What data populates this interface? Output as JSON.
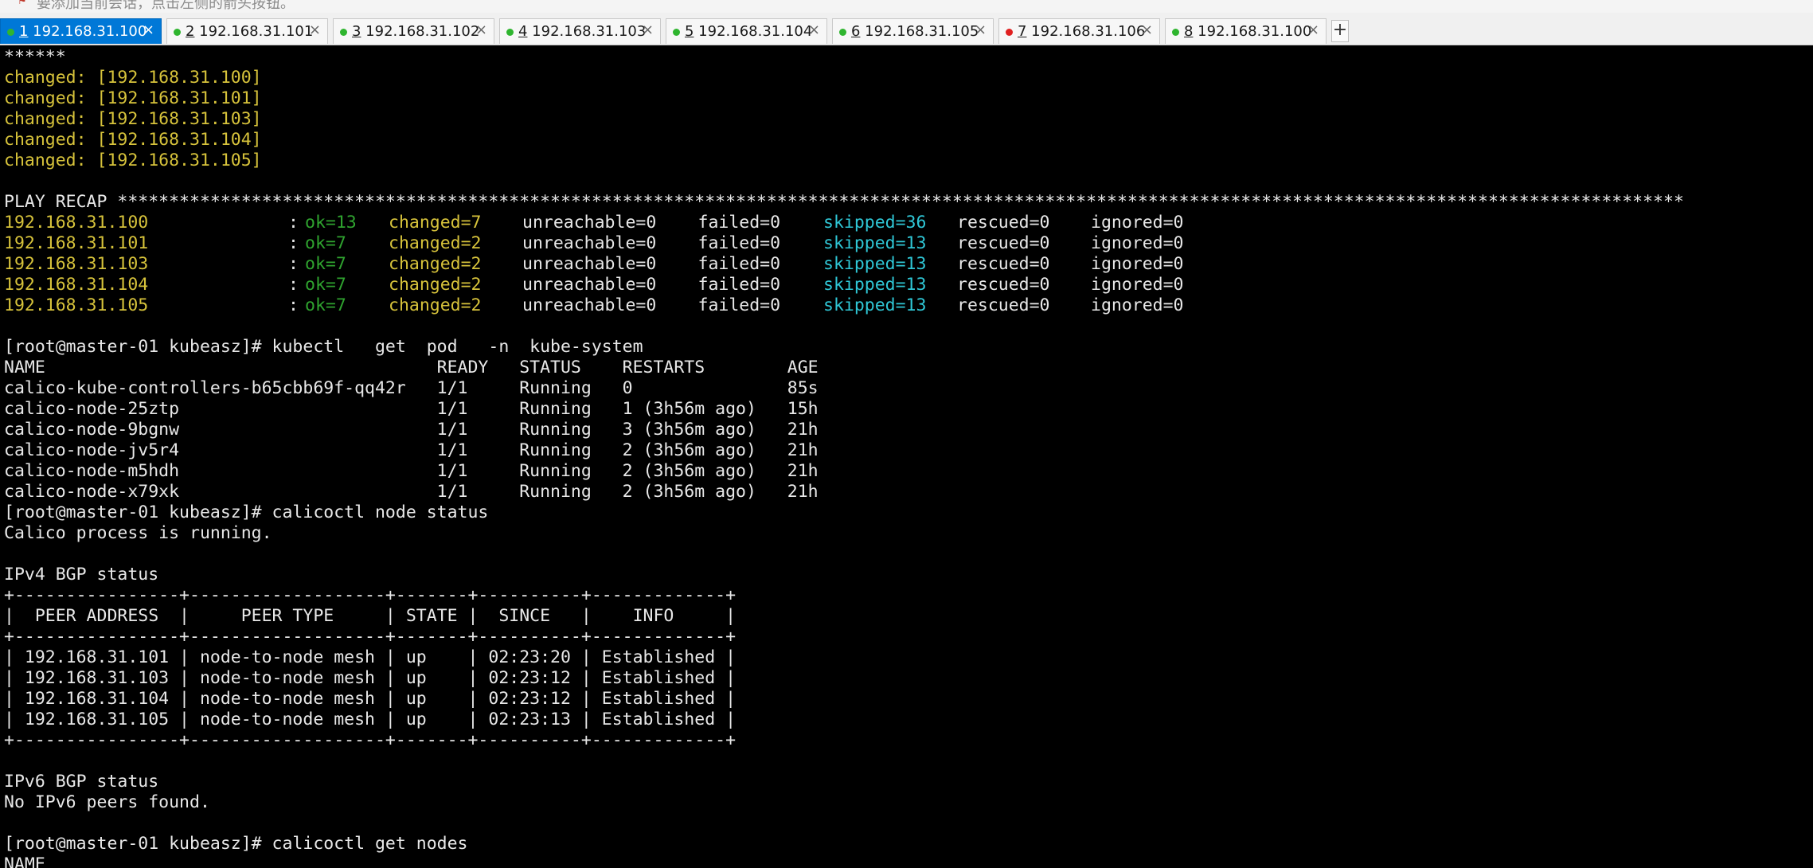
{
  "hint": {
    "text": "要添加当前会话，点击左侧的箭头按钮。"
  },
  "tabs": [
    {
      "num": "1",
      "host": "192.168.31.100",
      "status": "#2fb52f",
      "active": true
    },
    {
      "num": "2",
      "host": "192.168.31.101",
      "status": "#2fb52f",
      "active": false
    },
    {
      "num": "3",
      "host": "192.168.31.102",
      "status": "#2fb52f",
      "active": false
    },
    {
      "num": "4",
      "host": "192.168.31.103",
      "status": "#2fb52f",
      "active": false
    },
    {
      "num": "5",
      "host": "192.168.31.104",
      "status": "#2fb52f",
      "active": false
    },
    {
      "num": "6",
      "host": "192.168.31.105",
      "status": "#2fb52f",
      "active": false
    },
    {
      "num": "7",
      "host": "192.168.31.106",
      "status": "#e02020",
      "active": false
    },
    {
      "num": "8",
      "host": "192.168.31.100",
      "status": "#2fb52f",
      "active": false
    }
  ],
  "tab_close": "×",
  "new_tab_label": "+",
  "colors": {
    "yellow": "#d7c33b",
    "green": "#2fa32f",
    "cyan": "#2fc7d6",
    "text": "#e8e8e8",
    "tab_active": "#0078d7"
  },
  "terminal": {
    "lines": [
      {
        "segments": [
          {
            "t": "******",
            "c": ""
          }
        ]
      },
      {
        "segments": [
          {
            "t": "changed: [192.168.31.100]",
            "c": "yellow"
          }
        ]
      },
      {
        "segments": [
          {
            "t": "changed: [192.168.31.101]",
            "c": "yellow"
          }
        ]
      },
      {
        "segments": [
          {
            "t": "changed: [192.168.31.103]",
            "c": "yellow"
          }
        ]
      },
      {
        "segments": [
          {
            "t": "changed: [192.168.31.104]",
            "c": "yellow"
          }
        ]
      },
      {
        "segments": [
          {
            "t": "changed: [192.168.31.105]",
            "c": "yellow"
          }
        ]
      },
      {
        "segments": [
          {
            "t": "",
            "c": ""
          }
        ]
      },
      {
        "segments": [
          {
            "t": "PLAY RECAP ********************************************************************************************************************************************************",
            "c": ""
          }
        ]
      },
      {
        "segments": [
          {
            "t": "192.168.31.100",
            "c": "yellow",
            "col": 0
          },
          {
            "t": ": ",
            "c": "",
            "col": 34
          },
          {
            "t": "ok=13",
            "c": "green",
            "col": 36
          },
          {
            "t": "changed=7",
            "c": "yellow",
            "col": 46
          },
          {
            "t": "unreachable=0",
            "c": "",
            "col": 62
          },
          {
            "t": "failed=0",
            "c": "",
            "col": 83
          },
          {
            "t": "skipped=36",
            "c": "cyan",
            "col": 98
          },
          {
            "t": "rescued=0",
            "c": "",
            "col": 114
          },
          {
            "t": "ignored=0",
            "c": "",
            "col": 130
          }
        ]
      },
      {
        "segments": [
          {
            "t": "192.168.31.101",
            "c": "yellow",
            "col": 0
          },
          {
            "t": ": ",
            "c": "",
            "col": 34
          },
          {
            "t": "ok=7",
            "c": "green",
            "col": 36
          },
          {
            "t": "changed=2",
            "c": "yellow",
            "col": 46
          },
          {
            "t": "unreachable=0",
            "c": "",
            "col": 62
          },
          {
            "t": "failed=0",
            "c": "",
            "col": 83
          },
          {
            "t": "skipped=13",
            "c": "cyan",
            "col": 98
          },
          {
            "t": "rescued=0",
            "c": "",
            "col": 114
          },
          {
            "t": "ignored=0",
            "c": "",
            "col": 130
          }
        ]
      },
      {
        "segments": [
          {
            "t": "192.168.31.103",
            "c": "yellow",
            "col": 0
          },
          {
            "t": ": ",
            "c": "",
            "col": 34
          },
          {
            "t": "ok=7",
            "c": "green",
            "col": 36
          },
          {
            "t": "changed=2",
            "c": "yellow",
            "col": 46
          },
          {
            "t": "unreachable=0",
            "c": "",
            "col": 62
          },
          {
            "t": "failed=0",
            "c": "",
            "col": 83
          },
          {
            "t": "skipped=13",
            "c": "cyan",
            "col": 98
          },
          {
            "t": "rescued=0",
            "c": "",
            "col": 114
          },
          {
            "t": "ignored=0",
            "c": "",
            "col": 130
          }
        ]
      },
      {
        "segments": [
          {
            "t": "192.168.31.104",
            "c": "yellow",
            "col": 0
          },
          {
            "t": ": ",
            "c": "",
            "col": 34
          },
          {
            "t": "ok=7",
            "c": "green",
            "col": 36
          },
          {
            "t": "changed=2",
            "c": "yellow",
            "col": 46
          },
          {
            "t": "unreachable=0",
            "c": "",
            "col": 62
          },
          {
            "t": "failed=0",
            "c": "",
            "col": 83
          },
          {
            "t": "skipped=13",
            "c": "cyan",
            "col": 98
          },
          {
            "t": "rescued=0",
            "c": "",
            "col": 114
          },
          {
            "t": "ignored=0",
            "c": "",
            "col": 130
          }
        ]
      },
      {
        "segments": [
          {
            "t": "192.168.31.105",
            "c": "yellow",
            "col": 0
          },
          {
            "t": ": ",
            "c": "",
            "col": 34
          },
          {
            "t": "ok=7",
            "c": "green",
            "col": 36
          },
          {
            "t": "changed=2",
            "c": "yellow",
            "col": 46
          },
          {
            "t": "unreachable=0",
            "c": "",
            "col": 62
          },
          {
            "t": "failed=0",
            "c": "",
            "col": 83
          },
          {
            "t": "skipped=13",
            "c": "cyan",
            "col": 98
          },
          {
            "t": "rescued=0",
            "c": "",
            "col": 114
          },
          {
            "t": "ignored=0",
            "c": "",
            "col": 130
          }
        ]
      },
      {
        "segments": [
          {
            "t": "",
            "c": ""
          }
        ]
      },
      {
        "segments": [
          {
            "t": "[root@master-01 kubeasz]# kubectl   get  pod   -n  kube-system",
            "c": ""
          }
        ]
      },
      {
        "segments": [
          {
            "t": "NAME                                      READY   STATUS    RESTARTS        AGE",
            "c": ""
          }
        ]
      },
      {
        "segments": [
          {
            "t": "calico-kube-controllers-b65cbb69f-qq42r   1/1     Running   0               85s",
            "c": ""
          }
        ]
      },
      {
        "segments": [
          {
            "t": "calico-node-25ztp                         1/1     Running   1 (3h56m ago)   15h",
            "c": ""
          }
        ]
      },
      {
        "segments": [
          {
            "t": "calico-node-9bgnw                         1/1     Running   3 (3h56m ago)   21h",
            "c": ""
          }
        ]
      },
      {
        "segments": [
          {
            "t": "calico-node-jv5r4                         1/1     Running   2 (3h56m ago)   21h",
            "c": ""
          }
        ]
      },
      {
        "segments": [
          {
            "t": "calico-node-m5hdh                         1/1     Running   2 (3h56m ago)   21h",
            "c": ""
          }
        ]
      },
      {
        "segments": [
          {
            "t": "calico-node-x79xk                         1/1     Running   2 (3h56m ago)   21h",
            "c": ""
          }
        ]
      },
      {
        "segments": [
          {
            "t": "[root@master-01 kubeasz]# calicoctl node status",
            "c": ""
          }
        ]
      },
      {
        "segments": [
          {
            "t": "Calico process is running.",
            "c": ""
          }
        ]
      },
      {
        "segments": [
          {
            "t": "",
            "c": ""
          }
        ]
      },
      {
        "segments": [
          {
            "t": "IPv4 BGP status",
            "c": ""
          }
        ]
      },
      {
        "segments": [
          {
            "t": "+----------------+-------------------+-------+----------+-------------+",
            "c": ""
          }
        ]
      },
      {
        "segments": [
          {
            "t": "|  PEER ADDRESS  |     PEER TYPE     | STATE |  SINCE   |    INFO     |",
            "c": ""
          }
        ]
      },
      {
        "segments": [
          {
            "t": "+----------------+-------------------+-------+----------+-------------+",
            "c": ""
          }
        ]
      },
      {
        "segments": [
          {
            "t": "| 192.168.31.101 | node-to-node mesh | up    | 02:23:20 | Established |",
            "c": ""
          }
        ]
      },
      {
        "segments": [
          {
            "t": "| 192.168.31.103 | node-to-node mesh | up    | 02:23:12 | Established |",
            "c": ""
          }
        ]
      },
      {
        "segments": [
          {
            "t": "| 192.168.31.104 | node-to-node mesh | up    | 02:23:12 | Established |",
            "c": ""
          }
        ]
      },
      {
        "segments": [
          {
            "t": "| 192.168.31.105 | node-to-node mesh | up    | 02:23:13 | Established |",
            "c": ""
          }
        ]
      },
      {
        "segments": [
          {
            "t": "+----------------+-------------------+-------+----------+-------------+",
            "c": ""
          }
        ]
      },
      {
        "segments": [
          {
            "t": "",
            "c": ""
          }
        ]
      },
      {
        "segments": [
          {
            "t": "IPv6 BGP status",
            "c": ""
          }
        ]
      },
      {
        "segments": [
          {
            "t": "No IPv6 peers found.",
            "c": ""
          }
        ]
      },
      {
        "segments": [
          {
            "t": "",
            "c": ""
          }
        ]
      },
      {
        "segments": [
          {
            "t": "[root@master-01 kubeasz]# calicoctl get nodes",
            "c": ""
          }
        ]
      },
      {
        "segments": [
          {
            "t": "NAME",
            "c": ""
          }
        ]
      }
    ]
  }
}
